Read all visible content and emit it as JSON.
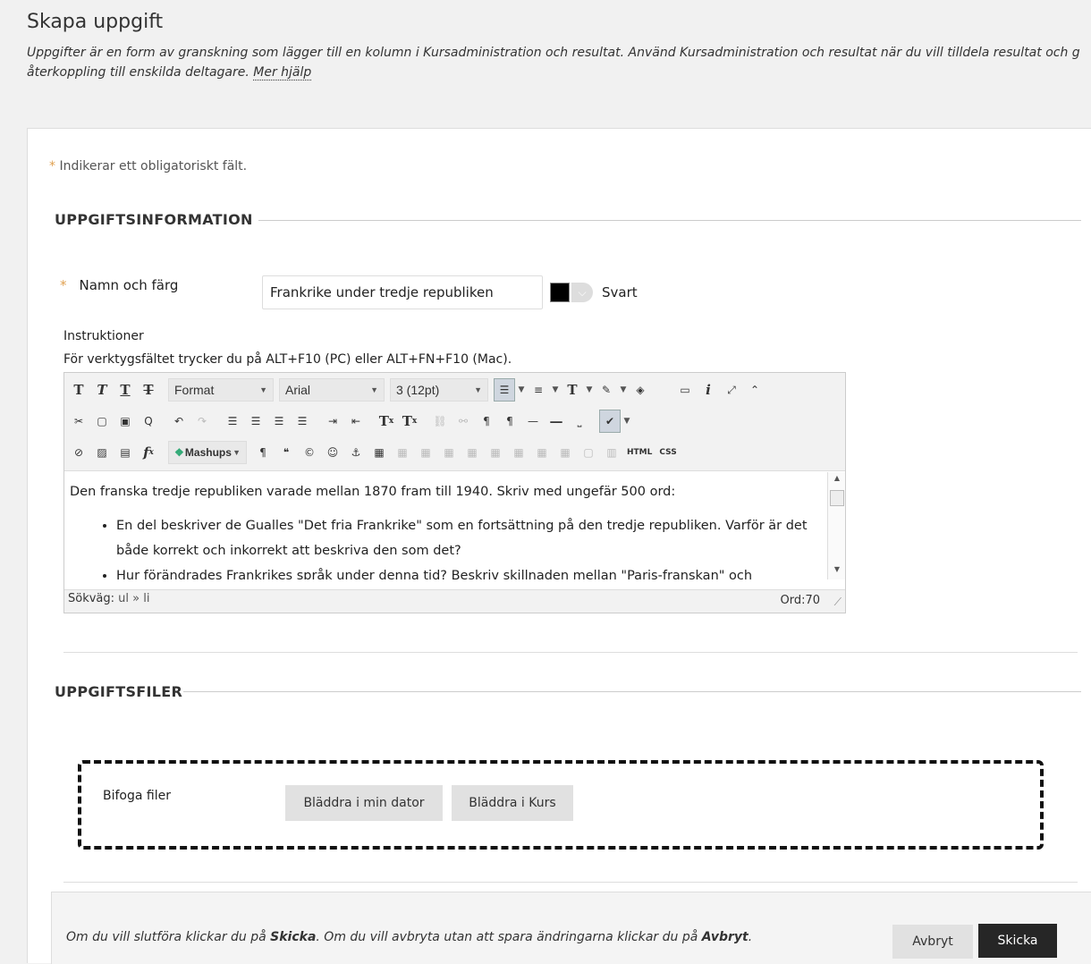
{
  "header": {
    "title": "Skapa uppgift",
    "description_line1": "Uppgifter är en form av granskning som lägger till en kolumn i Kursadministration och resultat. Använd Kursadministration och resultat när du vill tilldela resultat och g",
    "description_line2": "återkoppling till enskilda deltagare.",
    "help_link": "Mer hjälp"
  },
  "required_note": {
    "star": "*",
    "text": "Indikerar ett obligatoriskt fält."
  },
  "section_info": {
    "heading": "UPPGIFTSINFORMATION",
    "name_label": "Namn och färg",
    "name_value": "Frankrike under tredje republiken",
    "color_name": "Svart",
    "color_hex": "#000000",
    "instructions_label": "Instruktioner",
    "toolbar_hint": "För verktygsfältet trycker du på ALT+F10 (PC) eller ALT+FN+F10 (Mac)."
  },
  "editor": {
    "format_select": "Format",
    "font_select": "Arial",
    "size_select": "3 (12pt)",
    "mashups_label": "Mashups",
    "html_label": "HTML",
    "css_label": "CSS",
    "content_intro": "Den franska tredje republiken varade mellan 1870 fram till 1940. Skriv med ungefär 500 ord:",
    "bullets": [
      "En del beskriver de Gualles \"Det fria Frankrike\" som en fortsättning på den tredje republiken. Varför är det både korrekt och inkorrekt att beskriva den som det?",
      " Hur förändrades Frankrikes språk under denna tid? Beskriv skillnaden mellan \"Paris-franskan\" och"
    ],
    "path_label": "Sökväg:",
    "path_value": "ul » li",
    "word_count": "Ord:70"
  },
  "section_files": {
    "heading": "UPPGIFTSFILER",
    "attach_label": "Bifoga filer",
    "browse_computer": "Bläddra i min dator",
    "browse_course": "Bläddra i Kurs"
  },
  "footer": {
    "text_part1": "Om du vill slutföra klickar du på ",
    "text_submit_word": "Skicka",
    "text_part2": ". Om du vill avbryta utan att spara ändringarna klickar du på ",
    "text_cancel_word": "Avbryt",
    "text_part3": ".",
    "cancel_button": "Avbryt",
    "submit_button": "Skicka"
  }
}
